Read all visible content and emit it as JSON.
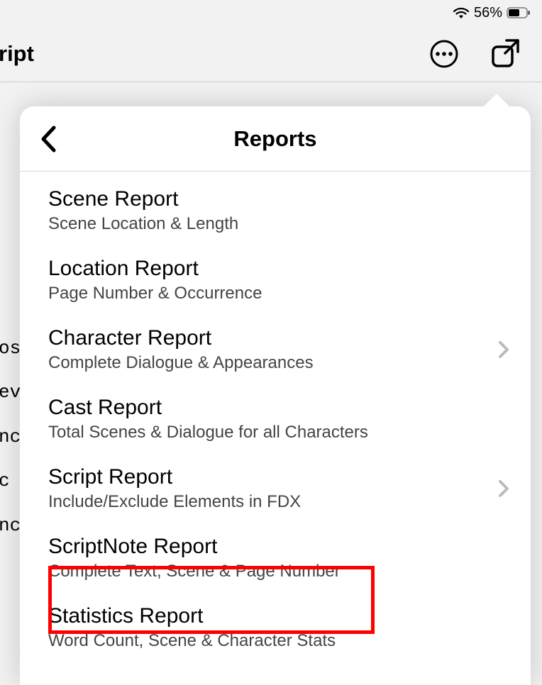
{
  "status_bar": {
    "battery_percent": "56%"
  },
  "top_bar": {
    "title": "ript"
  },
  "background_snippets": [
    "os",
    "ev",
    "nc",
    " c",
    "nc"
  ],
  "popover": {
    "title": "Reports",
    "items": [
      {
        "title": "Scene Report",
        "subtitle": "Scene Location & Length",
        "chevron": false
      },
      {
        "title": "Location Report",
        "subtitle": "Page Number & Occurrence",
        "chevron": false
      },
      {
        "title": "Character Report",
        "subtitle": "Complete Dialogue & Appearances",
        "chevron": true
      },
      {
        "title": "Cast Report",
        "subtitle": "Total Scenes & Dialogue for all Characters",
        "chevron": false
      },
      {
        "title": "Script Report",
        "subtitle": "Include/Exclude Elements in FDX",
        "chevron": true
      },
      {
        "title": "ScriptNote Report",
        "subtitle": "Complete Text, Scene & Page Number",
        "chevron": false
      },
      {
        "title": "Statistics Report",
        "subtitle": "Word Count, Scene & Character Stats",
        "chevron": false
      }
    ]
  }
}
